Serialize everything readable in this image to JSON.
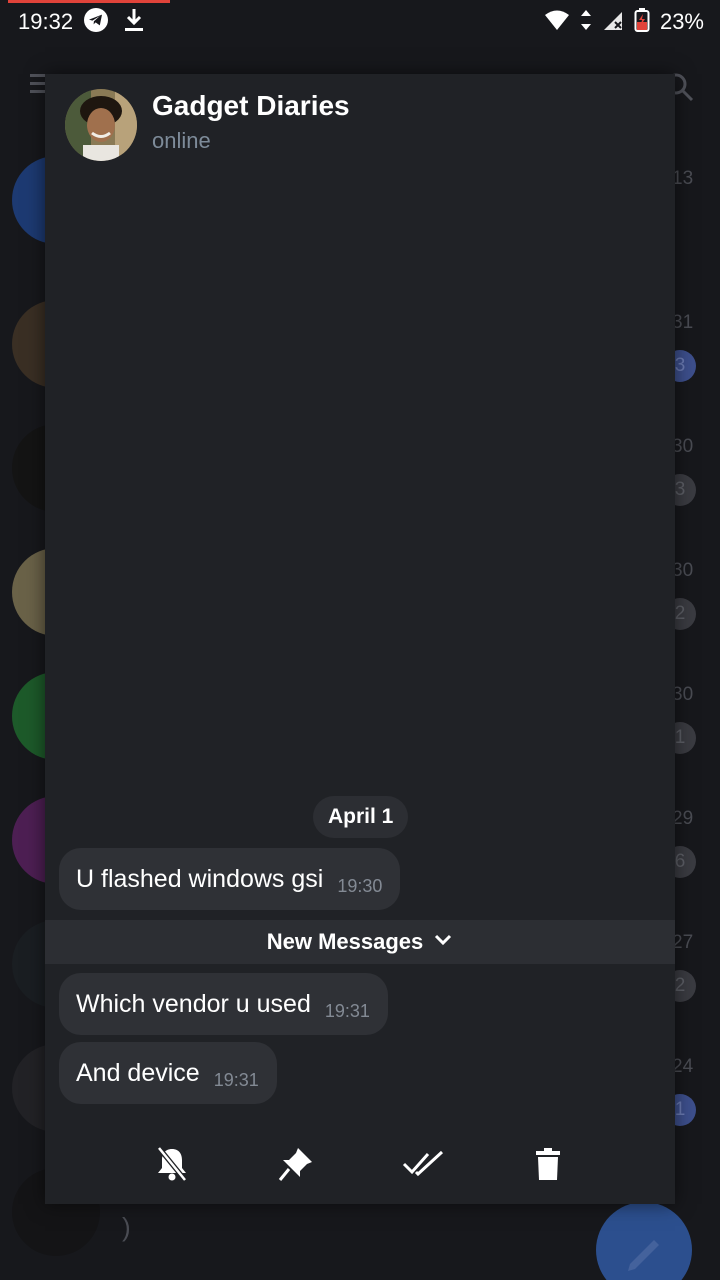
{
  "status_bar": {
    "time": "19:32",
    "battery_percent": "23%",
    "left_icons": [
      "telegram-icon",
      "download-icon"
    ],
    "right_icons": [
      "wifi-icon",
      "data-arrows-icon",
      "signal-icon",
      "battery-icon"
    ]
  },
  "background_list": {
    "rows": [
      {
        "time": "13",
        "badge": "",
        "avatar_color": "#1d3a72"
      },
      {
        "time": "31",
        "badge": "3",
        "avatar_color": "#3a2f24"
      },
      {
        "time": "30",
        "badge": "3",
        "avatar_color": "#141414"
      },
      {
        "time": "30",
        "badge": "2",
        "avatar_color": "#6a6248"
      },
      {
        "time": "30",
        "badge": "1",
        "avatar_color": "#1d5a2a"
      },
      {
        "time": "29",
        "badge": "6",
        "avatar_color": "#4d1f53"
      },
      {
        "time": "27",
        "badge": "2",
        "avatar_color": "#1a1e22"
      },
      {
        "time": "24",
        "badge": "1",
        "avatar_color": "#222226"
      },
      {
        "time": "",
        "badge": "",
        "avatar_color": "#141416"
      }
    ],
    "partial_text": ")"
  },
  "popup": {
    "title": "Gadget Diaries",
    "status": "online",
    "date_chip": "April 1",
    "messages_before": [
      {
        "text": "U flashed windows gsi",
        "time": "19:30"
      }
    ],
    "new_messages_label": "New Messages",
    "messages_after": [
      {
        "text": "Which vendor u used",
        "time": "19:31"
      },
      {
        "text": "And device",
        "time": "19:31"
      }
    ],
    "actions": [
      "mute-icon",
      "pin-icon",
      "mark-read-icon",
      "delete-icon"
    ]
  },
  "colors": {
    "background": "#17181c",
    "popup_bg": "#202226",
    "bubble_bg": "#2f3136",
    "status_online": "#7d8b99",
    "accent_blue": "#2c4f8e",
    "recording_bar": "#e0433a"
  }
}
